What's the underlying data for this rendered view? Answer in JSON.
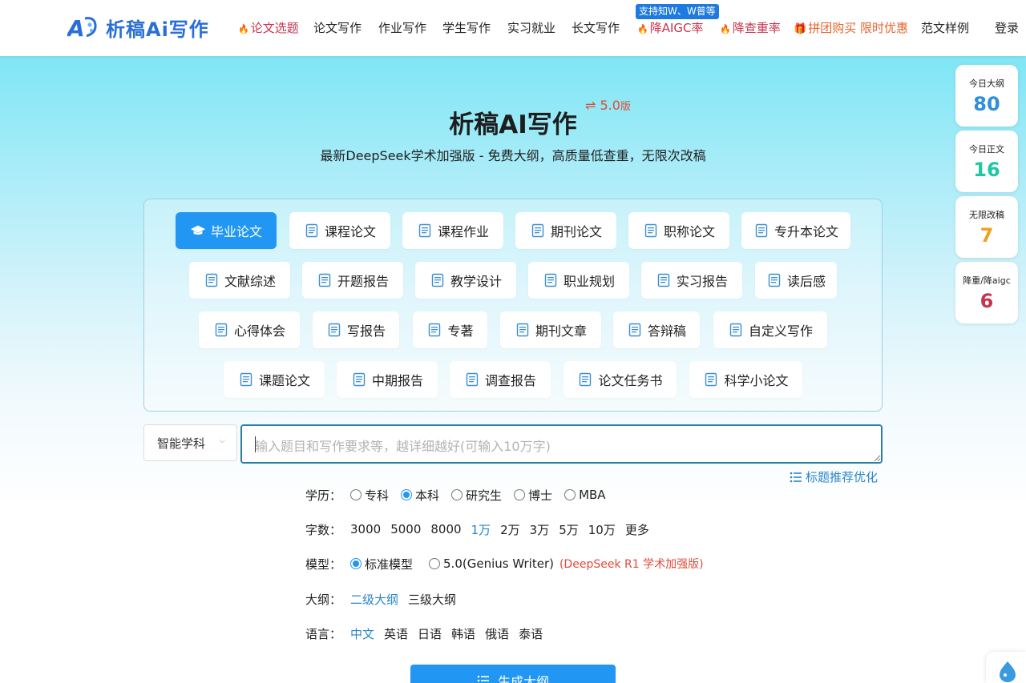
{
  "header": {
    "logo_text": "析稿Ai写作",
    "login_label": "登录",
    "badge": "支持知W、W普等",
    "nav": [
      {
        "label": "论文选题",
        "hot": true
      },
      {
        "label": "论文写作"
      },
      {
        "label": "作业写作"
      },
      {
        "label": "学生写作"
      },
      {
        "label": "实习就业"
      },
      {
        "label": "长文写作"
      },
      {
        "label": "降AIGC率",
        "hot": true
      },
      {
        "label": "降查重率",
        "hot": true
      },
      {
        "label": "拼团购买 限时优惠",
        "promo": true
      },
      {
        "label": "范文样例"
      }
    ]
  },
  "hero": {
    "title": "析稿AI写作",
    "version_prefix": "⇌ ",
    "version": "5.0",
    "version_suffix": "版",
    "subtitle": "最新DeepSeek学术加强版 - 免费大纲，高质量低查重，无限次改稿"
  },
  "categories": [
    [
      "毕业论文",
      "课程论文",
      "课程作业",
      "期刊论文",
      "职称论文",
      "专升本论文"
    ],
    [
      "文献综述",
      "开题报告",
      "教学设计",
      "职业规划",
      "实习报告",
      "读后感"
    ],
    [
      "心得体会",
      "写报告",
      "专著",
      "期刊文章",
      "答辩稿",
      "自定义写作"
    ],
    [
      "课题论文",
      "中期报告",
      "调查报告",
      "论文任务书",
      "科学小论文"
    ]
  ],
  "active_category": "毕业论文",
  "form": {
    "subject": "智能学科",
    "topic_placeholder": "输入题目和写作要求等，越详细越好(可输入10万字)",
    "suggest_label": "标题推荐优化",
    "education": {
      "label": "学历：",
      "options": [
        "专科",
        "本科",
        "研究生",
        "博士",
        "MBA"
      ],
      "selected": "本科"
    },
    "word_count": {
      "label": "字数：",
      "options": [
        "3000",
        "5000",
        "8000",
        "1万",
        "2万",
        "3万",
        "5万",
        "10万",
        "更多"
      ],
      "selected": "1万"
    },
    "model": {
      "label": "模型：",
      "options": [
        "标准模型",
        "5.0(Genius Writer)"
      ],
      "selected": "标准模型",
      "note": "(DeepSeek R1 学术加强版)"
    },
    "outline": {
      "label": "大纲：",
      "options": [
        "二级大纲",
        "三级大纲"
      ],
      "selected": "二级大纲"
    },
    "language": {
      "label": "语言：",
      "options": [
        "中文",
        "英语",
        "日语",
        "韩语",
        "俄语",
        "泰语"
      ],
      "selected": "中文"
    },
    "generate_label": "生成大纲"
  },
  "stats": [
    {
      "label": "今日大纲",
      "value": "80",
      "color": "#2f8fd8"
    },
    {
      "label": "今日正文",
      "value": "16",
      "color": "#1fc7a3"
    },
    {
      "label": "无限改稿",
      "value": "7",
      "color": "#f0a020"
    },
    {
      "label": "降重/降aigc",
      "value": "6",
      "color": "#c8334e"
    }
  ]
}
